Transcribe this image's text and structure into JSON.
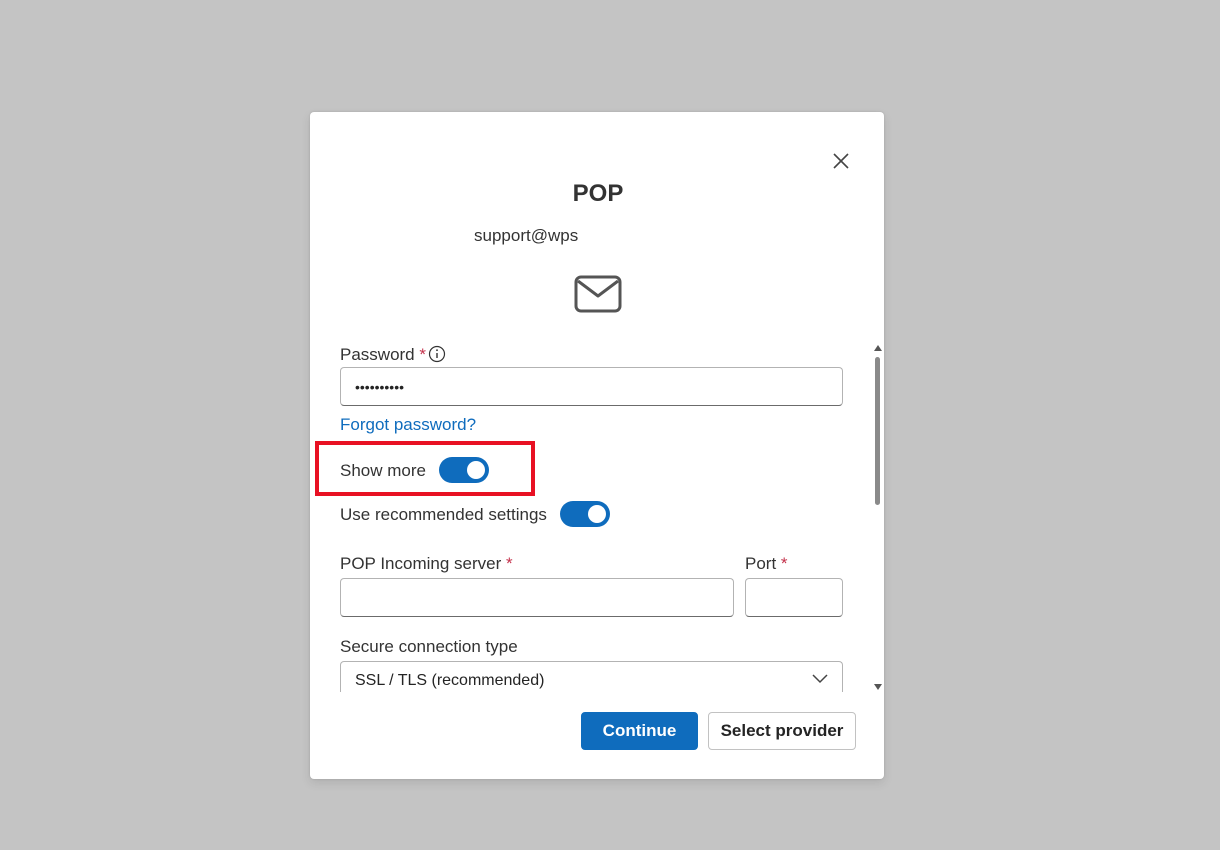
{
  "dialog": {
    "title": "POP",
    "email": "support@wps",
    "close_icon": "close-icon",
    "mail_icon": "envelope-icon"
  },
  "form": {
    "password_label": "Password",
    "required_mark": "*",
    "password_value": "••••••••••",
    "forgot_password": "Forgot password?",
    "show_more_label": "Show more",
    "show_more_on": true,
    "recommended_label": "Use recommended settings",
    "recommended_on": true,
    "incoming_server_label": "POP Incoming server",
    "incoming_server_value": "",
    "port_label": "Port",
    "port_value": "",
    "secure_label": "Secure connection type",
    "secure_value": "SSL / TLS (recommended)"
  },
  "buttons": {
    "continue": "Continue",
    "select_provider": "Select provider"
  },
  "colors": {
    "accent": "#0f6cbd",
    "required": "#c4314b",
    "highlight": "#e81123"
  }
}
